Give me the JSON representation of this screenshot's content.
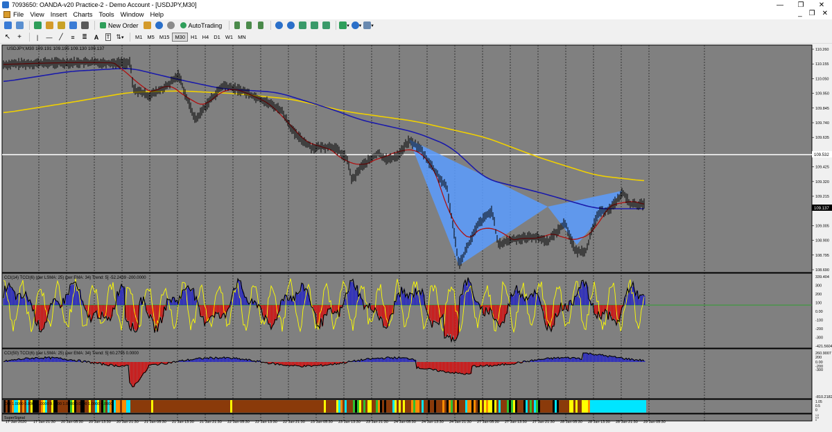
{
  "window": {
    "title": "7093650: OANDA-v20 Practice-2 - Demo Account - [USDJPY,M30]",
    "minimize": "—",
    "restore": "❐",
    "close": "✕"
  },
  "menu": {
    "items": [
      "File",
      "View",
      "Insert",
      "Charts",
      "Tools",
      "Window",
      "Help"
    ]
  },
  "toolbar": {
    "new_order": "New Order",
    "autotrading": "AutoTrading",
    "timeframes": [
      "M1",
      "M5",
      "M15",
      "M30",
      "H1",
      "H4",
      "D1",
      "W1",
      "MN"
    ],
    "active_timeframe": "M30"
  },
  "chart": {
    "header": "USDJPY,M30  109.191 109.195 109.130 109.137",
    "price_labels": [
      "110.260",
      "110.155",
      "110.050",
      "109.950",
      "109.845",
      "109.740",
      "109.635",
      "109.532",
      "109.425",
      "109.320",
      "109.215",
      "109.137",
      "109.005",
      "108.900",
      "108.795",
      "108.690"
    ],
    "hline_label": "109.532",
    "current_price": "109.137",
    "date_labels": [
      "17 Jan 2020",
      "17 Jan 21:30",
      "20 Jan 05:30",
      "20 Jan 13:30",
      "20 Jan 21:30",
      "21 Jan 05:30",
      "21 Jan 13:30",
      "21 Jan 21:30",
      "22 Jan 05:30",
      "22 Jan 13:30",
      "22 Jan 21:30",
      "23 Jan 05:30",
      "23 Jan 13:30",
      "23 Jan 21:30",
      "24 Jan 05:30",
      "24 Jan 13:30",
      "24 Jan 21:30",
      "27 Jan 05:30",
      "27 Jan 13:30",
      "27 Jan 21:30",
      "28 Jan 05:30",
      "28 Jan 13:30",
      "28 Jan 21:30",
      "29 Jan 05:30"
    ]
  },
  "cci1": {
    "header": "CCI(14) TCCI(6) (per LSMA: 25) (per EMA: 34) Trend: 5]  -52.2439  -200.0000",
    "labels": [
      "339.404",
      "300",
      "200",
      "100",
      "0.00",
      "-100",
      "-200",
      "-300",
      "-421.5604"
    ]
  },
  "cci2": {
    "header": "CCI(50) TCCI(6) (per LSMA: 25) (per EMA: 34) Trend: 5]  60.2795  0.0000",
    "labels": [
      "260.9007",
      "200",
      "0.00",
      "-200",
      "-300",
      "-810.2182"
    ]
  },
  "strip": {
    "header": "CCI  1.0000  0.0000  1.0000  0.0000  1.0000  0.0000  1.0000  0.0000",
    "labels": [
      "1.05",
      "0.5",
      "0"
    ],
    "footer": "SuperSignal",
    "footer_labels": [
      "1.0",
      "0.5",
      "0"
    ]
  },
  "colors": {
    "chart_bg": "#808080",
    "ma_blue": "#1a1aaa",
    "ma_yellow": "#f0d000",
    "ma_red": "#b01010",
    "pattern": "#5a9cff",
    "hist_red": "#e00000",
    "hist_blue": "#1a1acc"
  }
}
